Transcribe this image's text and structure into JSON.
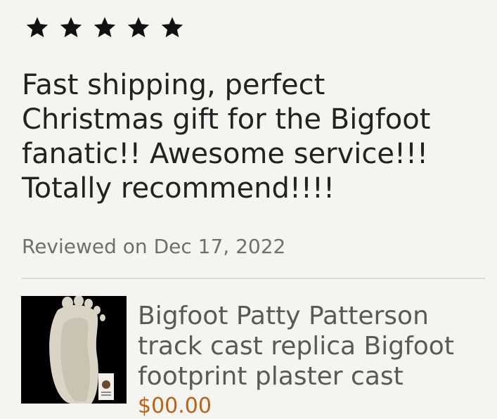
{
  "review": {
    "rating": 5,
    "rating_max": 5,
    "text": "Fast shipping, perfect Christmas gift for the Bigfoot fanatic!! Awesome service!!! Totally recommend!!!!",
    "date": "Reviewed on Dec 17, 2022"
  },
  "product": {
    "title": "Bigfoot Patty Patterson track cast replica Bigfoot footprint plaster cast",
    "price": "$00.00",
    "thumbnail_icon": "footprint-cast-image"
  },
  "colors": {
    "background": "#f5f4f0",
    "star": "#111111",
    "price": "#b8631b"
  }
}
